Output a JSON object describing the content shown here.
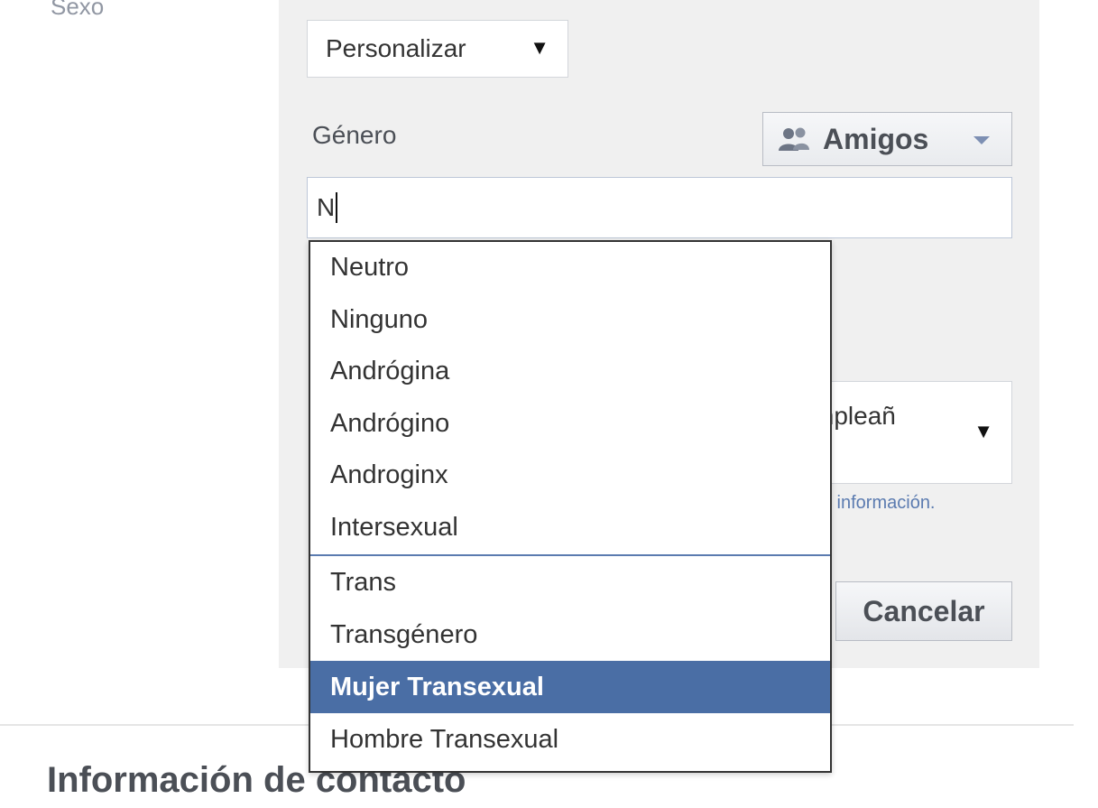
{
  "sexo_label": "Sexo",
  "sex_select": {
    "value": "Personalizar"
  },
  "gender_field": {
    "label": "Género",
    "value": "N"
  },
  "audience_button": {
    "label": "Amigos",
    "icon": "friends-icon"
  },
  "gender_suggestions": {
    "items": [
      "Neutro",
      "Ninguno",
      "Andrógina",
      "Andrógino",
      "Androginx",
      "Intersexual",
      "Trans",
      "Transgénero",
      "Mujer Transexual",
      "Hombre Transexual"
    ],
    "selected": "Mujer Transexual"
  },
  "birthday_select": {
    "partial_text": "mpleañ"
  },
  "more_info_link": "s información.",
  "cancel_button": "Cancelar",
  "contact_section": {
    "title": "Información de contacto"
  },
  "colors": {
    "panel_bg": "#f0f0f0",
    "selection_bg": "#4a6ea5",
    "link": "#5b7bb0"
  }
}
